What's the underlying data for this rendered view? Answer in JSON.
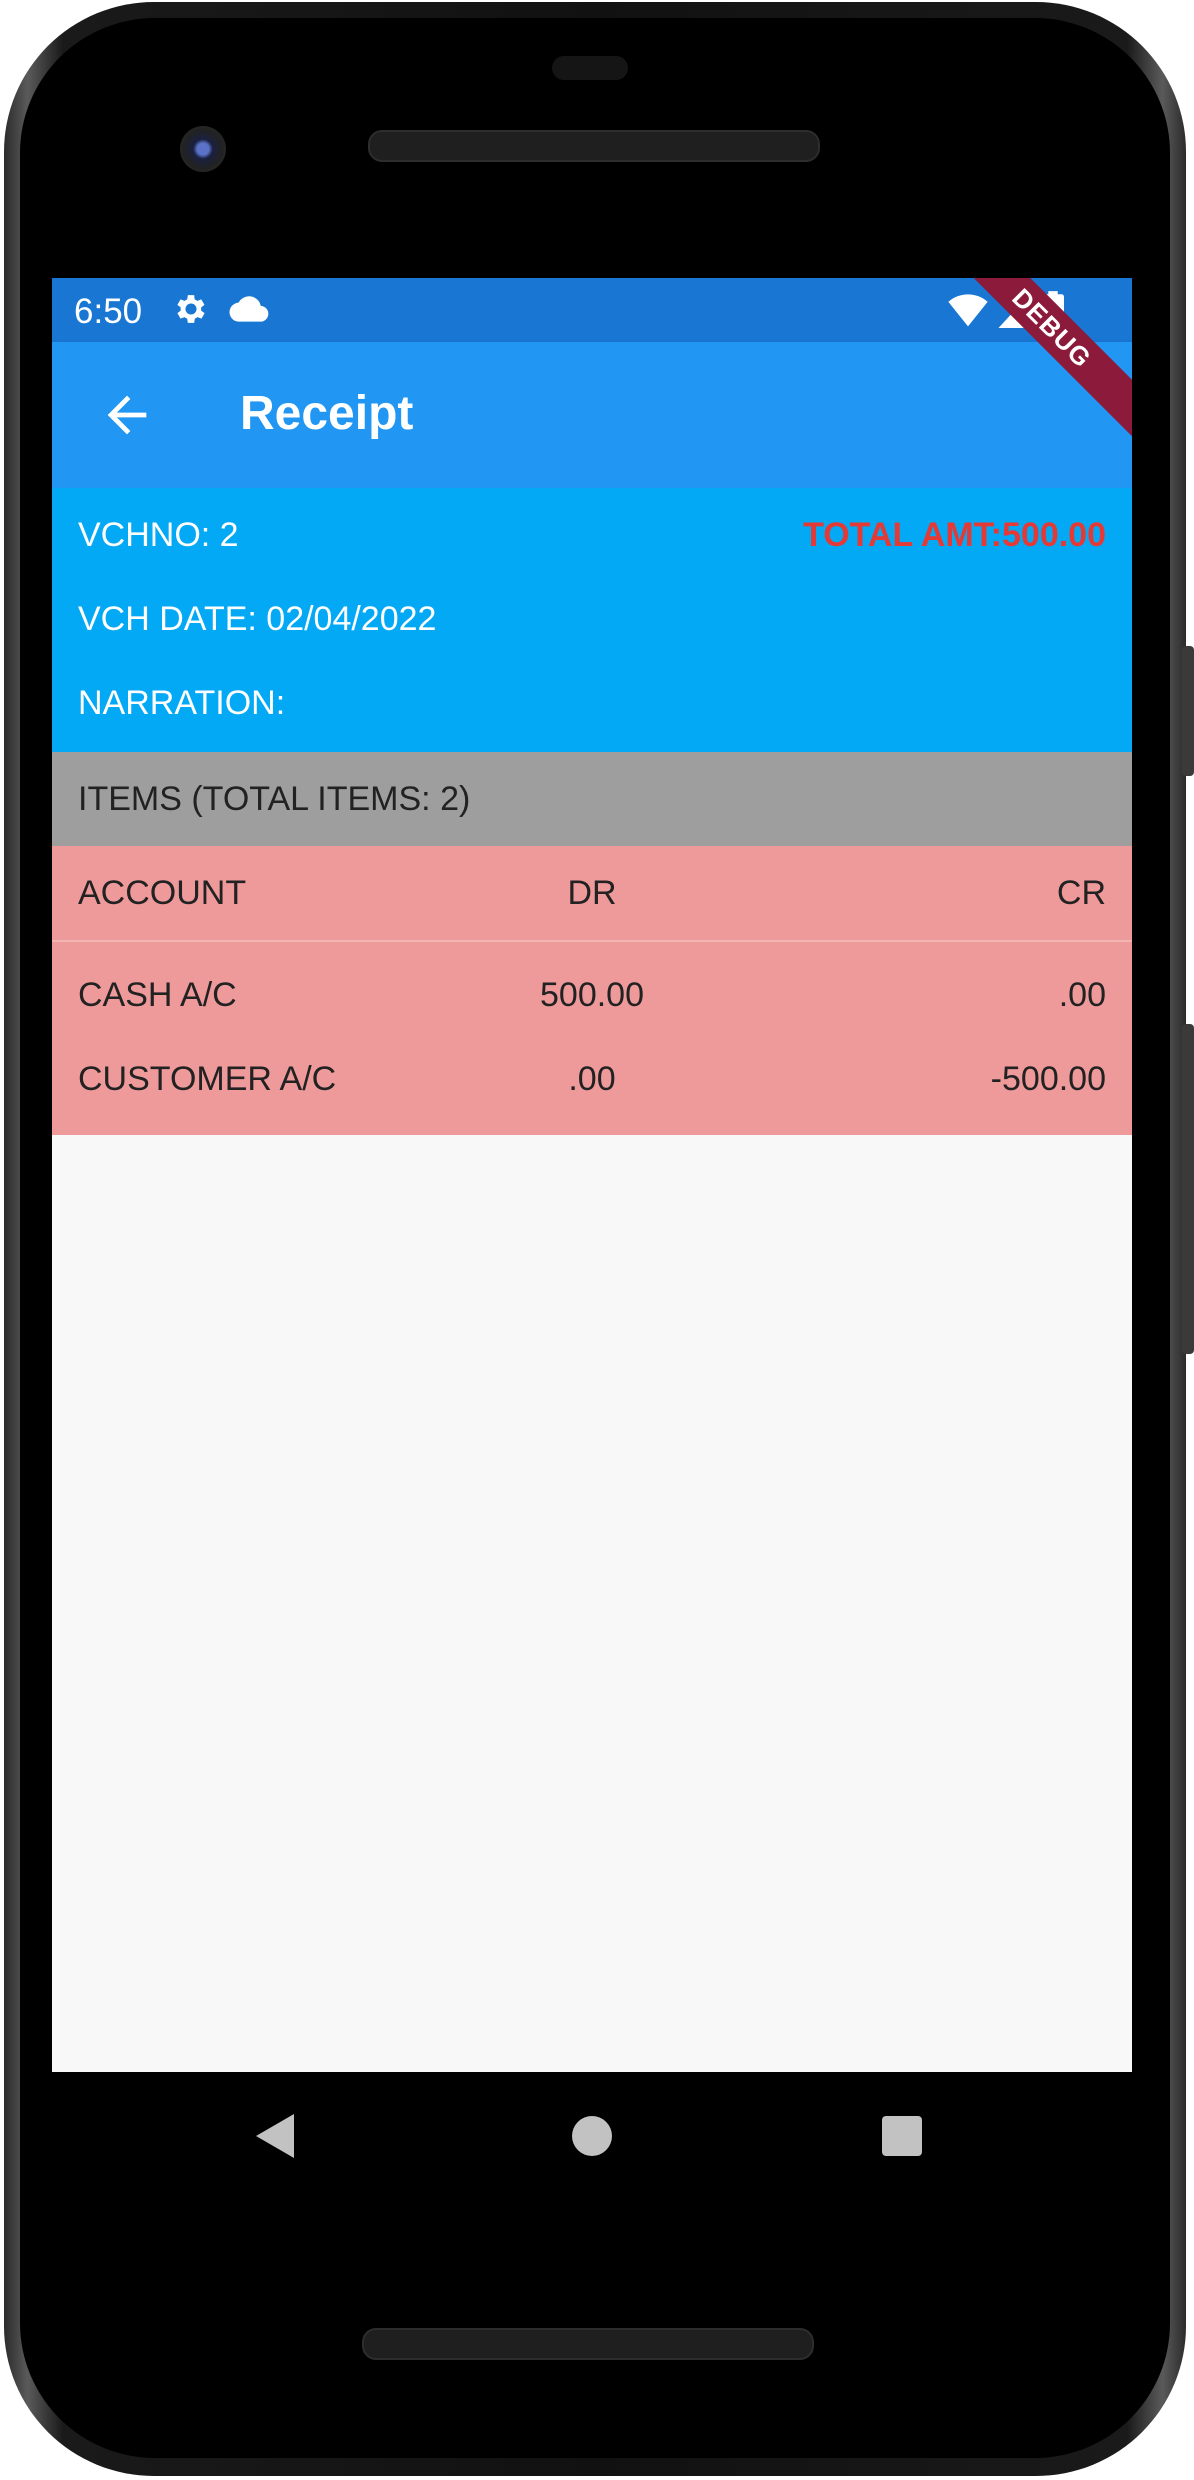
{
  "status_bar": {
    "time": "6:50",
    "left_icons": [
      "gear-icon",
      "cloud-icon"
    ],
    "right_icons": [
      "wifi-icon",
      "signal-icon",
      "battery-icon"
    ]
  },
  "app_bar": {
    "title": "Receipt",
    "back_icon": "arrow-back-icon"
  },
  "debug_banner": "DEBUG",
  "voucher": {
    "vchno": "VCHNO: 2",
    "total_amount": "TOTAL AMT:500.00",
    "vch_date": "VCH DATE: 02/04/2022",
    "narration": "NARRATION:"
  },
  "items_header": "ITEMS (TOTAL ITEMS: 2)",
  "table": {
    "columns": [
      "ACCOUNT",
      "DR",
      "CR"
    ],
    "rows": [
      {
        "account": "CASH A/C",
        "dr": "500.00",
        "cr": ".00"
      },
      {
        "account": "CUSTOMER A/C",
        "dr": ".00",
        "cr": "-500.00"
      }
    ]
  },
  "nav_bar": [
    "back-triangle-icon",
    "home-circle-icon",
    "recents-square-icon"
  ],
  "colors": {
    "status_bar": "#1976d2",
    "app_bar": "#2196f3",
    "header_panel": "#03a9f4",
    "total_amount": "#e53935",
    "items_bar": "#9e9e9e",
    "table_bg": "#ef9a9a",
    "debug_banner": "#8c1a3a"
  }
}
